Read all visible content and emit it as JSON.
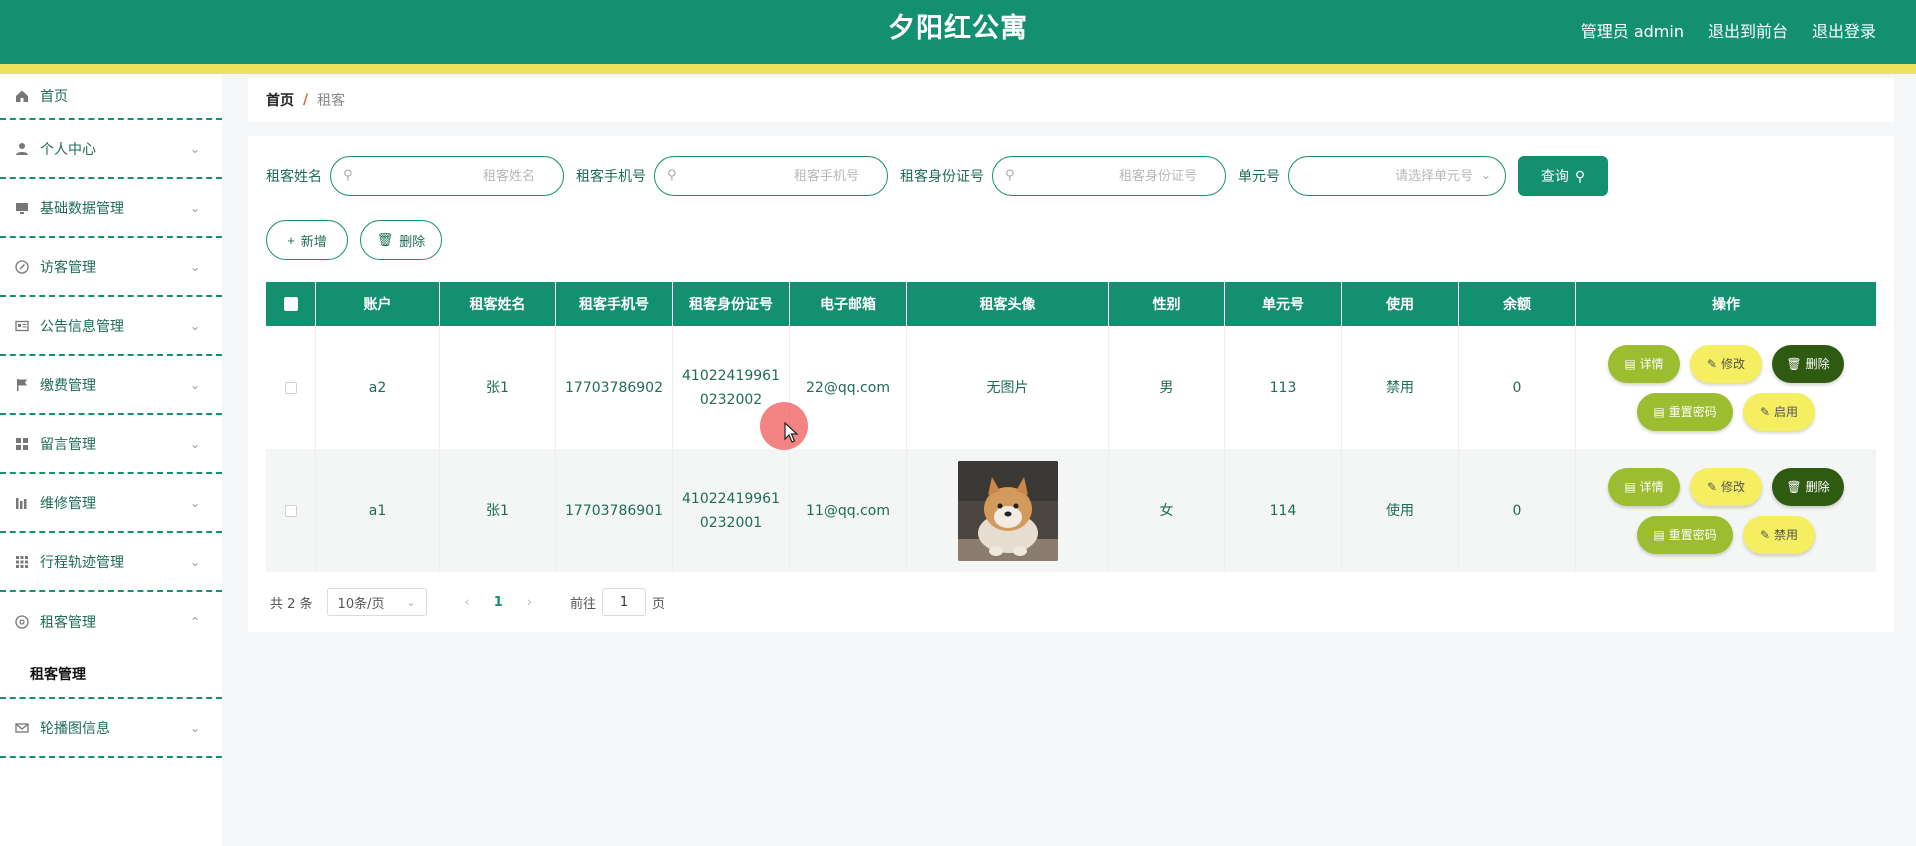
{
  "header": {
    "title": "夕阳红公寓",
    "admin": "管理员 admin",
    "to_front": "退出到前台",
    "logout": "退出登录"
  },
  "sidebar": {
    "items": [
      {
        "label": "首页",
        "icon": "home-icon"
      },
      {
        "label": "个人中心",
        "icon": "user-icon"
      },
      {
        "label": "基础数据管理",
        "icon": "monitor-icon"
      },
      {
        "label": "访客管理",
        "icon": "compass-icon"
      },
      {
        "label": "公告信息管理",
        "icon": "id-card-icon"
      },
      {
        "label": "缴费管理",
        "icon": "flag-icon"
      },
      {
        "label": "留言管理",
        "icon": "grid-icon"
      },
      {
        "label": "维修管理",
        "icon": "chart-icon"
      },
      {
        "label": "行程轨迹管理",
        "icon": "apps-icon"
      },
      {
        "label": "租客管理",
        "icon": "aperture-icon"
      },
      {
        "label": "轮播图信息",
        "icon": "mail-icon"
      }
    ],
    "sub_item": "租客管理"
  },
  "breadcrumb": {
    "home": "首页",
    "separator": "/",
    "current": "租客"
  },
  "search": {
    "name_label": "租客姓名",
    "name_placeholder": "租客姓名",
    "phone_label": "租客手机号",
    "phone_placeholder": "租客手机号",
    "idcard_label": "租客身份证号",
    "idcard_placeholder": "租客身份证号",
    "unit_label": "单元号",
    "unit_placeholder": "请选择单元号",
    "query_label": "查询"
  },
  "actions": {
    "add_label": "新增",
    "delete_label": "删除"
  },
  "table": {
    "headers": [
      "账户",
      "租客姓名",
      "租客手机号",
      "租客身份证号",
      "电子邮箱",
      "租客头像",
      "性别",
      "单元号",
      "使用",
      "余额",
      "操作"
    ],
    "rows": [
      {
        "account": "a2",
        "name": "张1",
        "phone": "17703786902",
        "idcard": "410224199610232002",
        "email": "22@qq.com",
        "avatar_text": "无图片",
        "gender": "男",
        "unit": "113",
        "status": "禁用",
        "balance": "0",
        "toggle_label": "启用"
      },
      {
        "account": "a1",
        "name": "张1",
        "phone": "17703786901",
        "idcard": "410224199610232001",
        "email": "11@qq.com",
        "avatar_text": "",
        "gender": "女",
        "unit": "114",
        "status": "使用",
        "balance": "0",
        "toggle_label": "禁用"
      }
    ],
    "op_labels": {
      "detail": "详情",
      "edit": "修改",
      "delete": "删除",
      "reset": "重置密码"
    }
  },
  "pagination": {
    "total": "共 2 条",
    "page_size": "10条/页",
    "current_page": "1",
    "goto_label": "前往",
    "goto_value": "1",
    "page_unit": "页"
  },
  "colors": {
    "primary": "#139070",
    "accent_yellow": "#ece25e",
    "detail_green": "#9bbd2f",
    "delete_dark": "#2f5a12"
  }
}
